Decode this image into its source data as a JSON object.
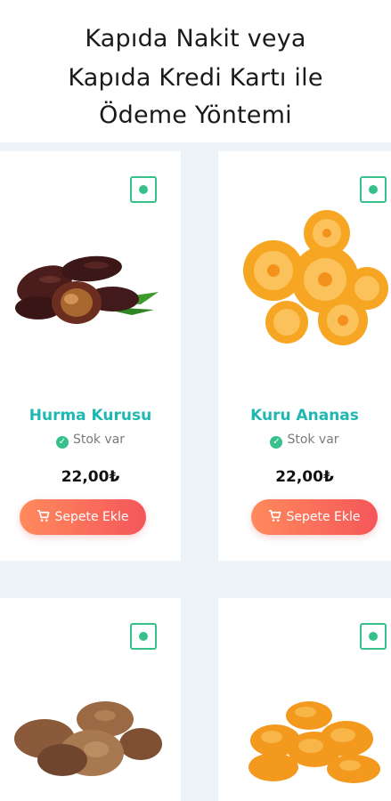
{
  "header": {
    "line1": "Kapıda Nakit veya",
    "line2": "Kapıda Kredi Kartı ile",
    "line3": "Ödeme Yöntemi"
  },
  "colors": {
    "accent_text": "#1fb8b0",
    "badge_green": "#36c08a",
    "button_gradient_start": "#ff8a5c",
    "button_gradient_end": "#f5565a"
  },
  "products": [
    {
      "name": "Hurma Kurusu",
      "stock": "Stok var",
      "price": "22,00₺",
      "button": "Sepete Ekle",
      "image": "dates-image",
      "badge": "veg-badge-icon"
    },
    {
      "name": "Kuru Ananas",
      "stock": "Stok var",
      "price": "22,00₺",
      "button": "Sepete Ekle",
      "image": "dried-pineapple-image",
      "badge": "veg-badge-icon"
    },
    {
      "image": "dried-figs-image",
      "badge": "veg-badge-icon"
    },
    {
      "image": "dried-apricots-image",
      "badge": "veg-badge-icon"
    }
  ]
}
